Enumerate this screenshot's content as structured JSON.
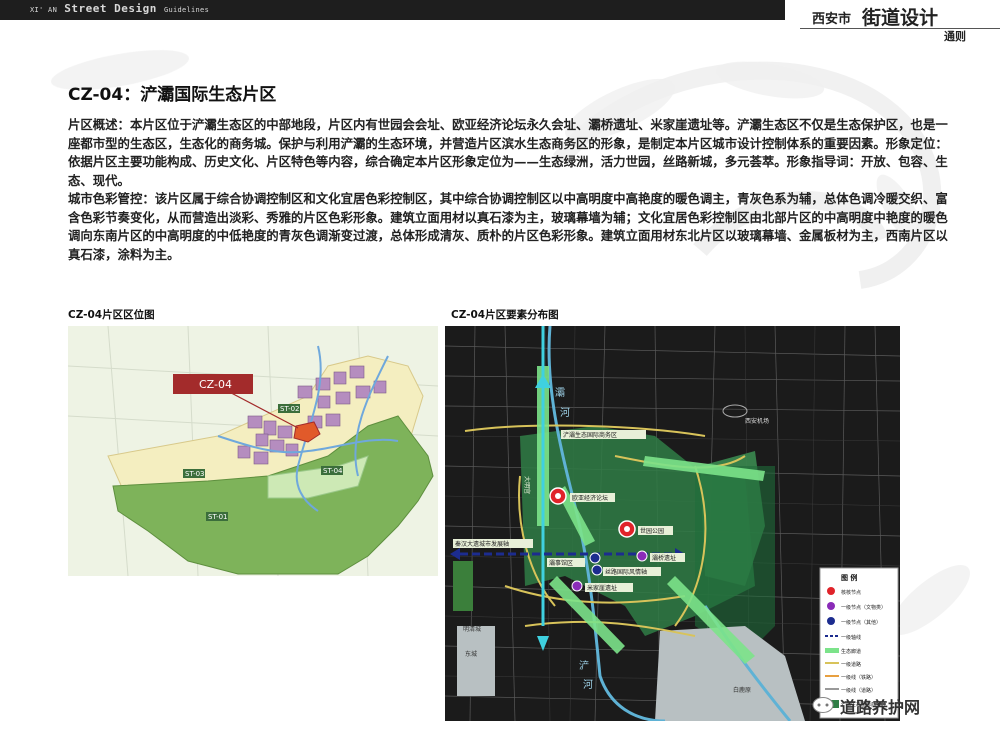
{
  "header": {
    "brand_prefix": "XI' AN",
    "brand_main": "Street Design",
    "brand_suffix": "Guidelines",
    "city": "西安市",
    "title": "街道设计",
    "subtitle": "通则"
  },
  "page": {
    "title": "CZ-04：浐灞国际生态片区",
    "paragraphs": [
      "片区概述：本片区位于浐灞生态区的中部地段，片区内有世园会会址、欧亚经济论坛永久会址、灞桥遗址、米家崖遗址等。浐灞生态区不仅是生态保护区，也是一座都市型的生态区，生态化的商务城。保护与利用浐灞的生态环境，并营造片区滨水生态商务区的形象，是制定本片区城市设计控制体系的重要因素。形象定位：依据片区主要功能构成、历史文化、片区特色等内容，综合确定本片区形象定位为——生态绿洲，活力世园，丝路新城，多元荟萃。形象指导词：开放、包容、生态、现代。",
      "城市色彩管控：该片区属于综合协调控制区和文化宜居色彩控制区，其中综合协调控制区以中高明度中高艳度的暖色调主，青灰色系为辅，总体色调冷暖交织、富含色彩节奏变化，从而营造出淡彩、秀雅的片区色彩形象。建筑立面用材以真石漆为主，玻璃幕墙为辅；文化宜居色彩控制区由北部片区的中高明度中艳度的暖色调向东南片区的中高明度的中低艳度的青灰色调渐变过渡，总体形成清灰、质朴的片区色彩形象。建筑立面用材东北片区以玻璃幕墙、金属板材为主，西南片区以真石漆，涂料为主。"
    ]
  },
  "figures": {
    "left_caption": "CZ-04片区区位图",
    "right_caption": "CZ-04片区要素分布图"
  },
  "location_map": {
    "callout": "CZ-04",
    "zone_labels": [
      "ST-02",
      "ST-03",
      "ST-04",
      "ST-01"
    ]
  },
  "element_map": {
    "labels": [
      "浐灞生态国际商务区",
      "欧亚经济论坛",
      "世园公园",
      "灞桥遗址",
      "丝路国际风情轴",
      "米家崖遗址",
      "灞事馆区",
      "秦汉大遗城市发展轴",
      "西安机场",
      "明清城",
      "白鹿原",
      "浐",
      "灞",
      "河",
      "浐",
      "河",
      "大明宫",
      "东城"
    ],
    "legend_title": "图  例",
    "legend_items": [
      "核核节点",
      "一级节点（文物类）",
      "一级节点（其他）",
      "一级轴线",
      "生态廊道",
      "一级道路",
      "一级线（铁路）",
      "一级线（道路）",
      "浐灞生态国际商务区"
    ]
  },
  "watermark": "道路养护网",
  "colors": {
    "topbar": "#1e1e1e",
    "map_green": "#7eb35a",
    "map_yellow": "#f4eec0",
    "callout_red": "#a32b2b",
    "node_red": "#e0232a",
    "node_purple": "#8a2bb8",
    "axis_blue": "#1c2c8f",
    "corridor_green": "#7ce38a",
    "road_yellow": "#d8c35a"
  }
}
